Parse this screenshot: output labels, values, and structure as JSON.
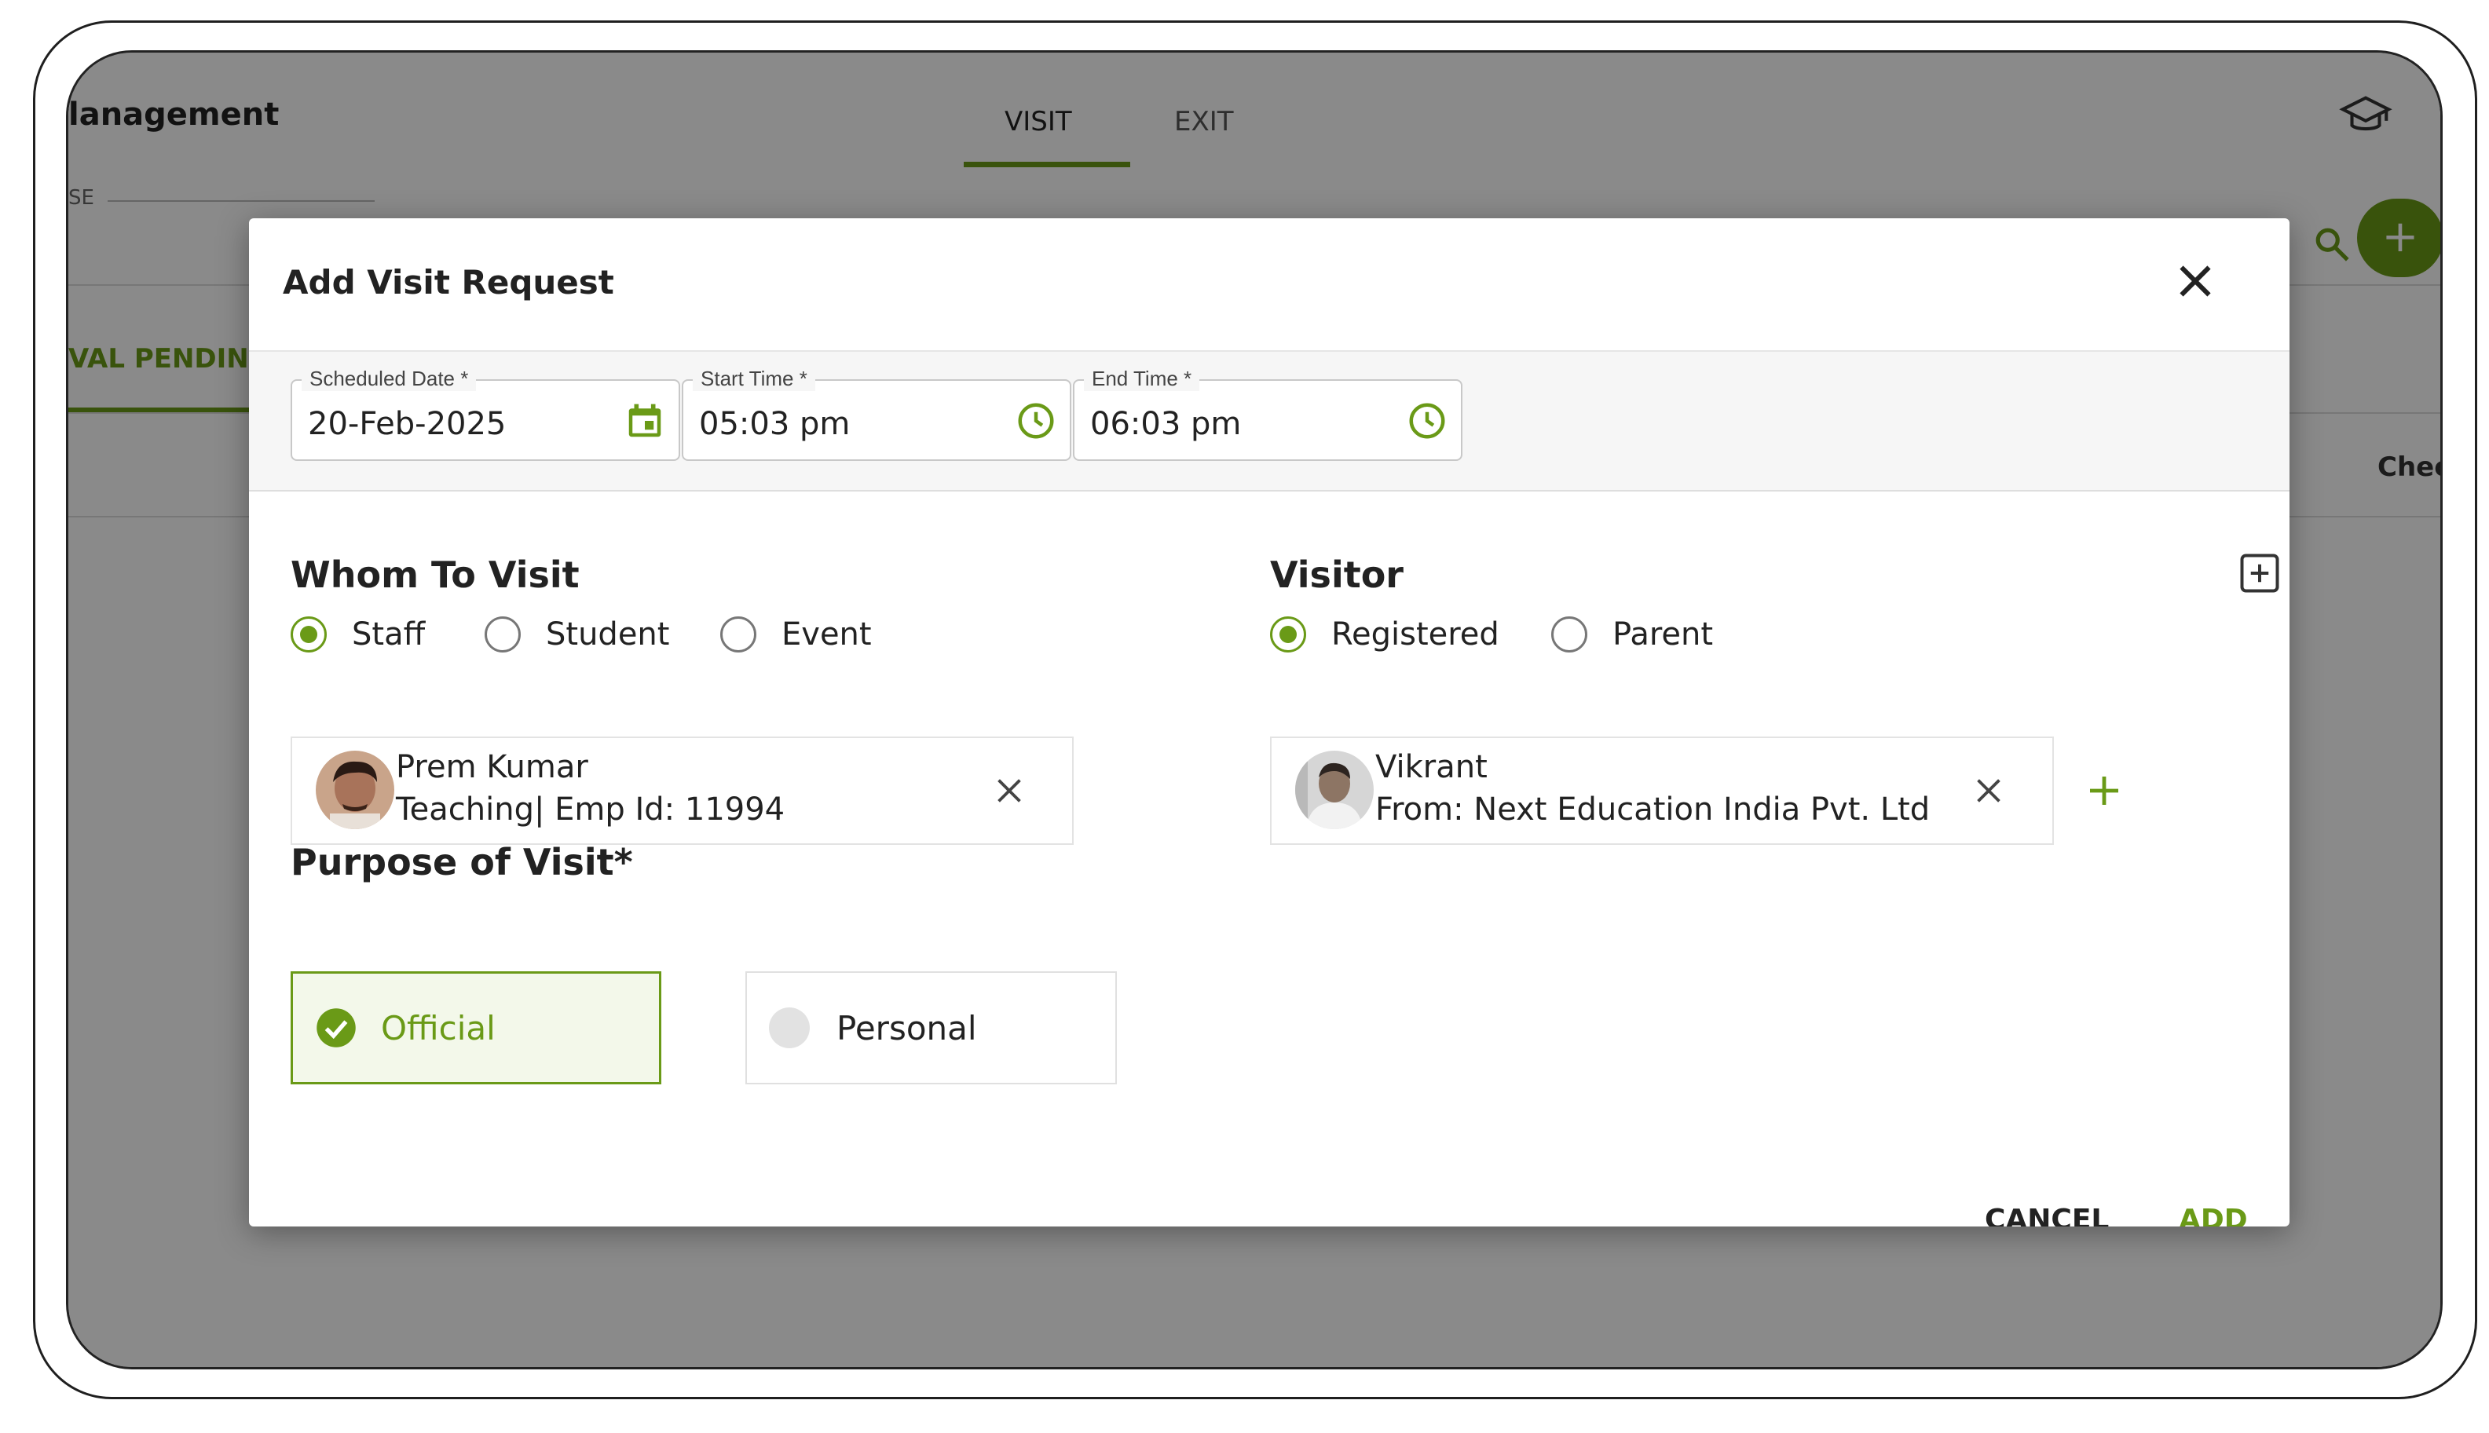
{
  "background_app": {
    "title": "lanagement",
    "tabs": [
      {
        "label": "VISIT",
        "active": true
      },
      {
        "label": "EXIT",
        "active": false
      }
    ],
    "field_label": "SE",
    "status_tab": "VAL PENDING",
    "column_header": "Chec",
    "add_button": "+"
  },
  "modal": {
    "title": "Add Visit Request",
    "schedule": {
      "date": {
        "label": "Scheduled Date *",
        "value": "20-Feb-2025",
        "icon": "calendar-icon"
      },
      "start": {
        "label": "Start Time *",
        "value": "05:03 pm",
        "icon": "clock-icon"
      },
      "end": {
        "label": "End Time *",
        "value": "06:03 pm",
        "icon": "clock-icon"
      }
    },
    "whom": {
      "heading": "Whom To Visit",
      "options": [
        {
          "label": "Staff",
          "selected": true
        },
        {
          "label": "Student",
          "selected": false
        },
        {
          "label": "Event",
          "selected": false
        }
      ],
      "selected": {
        "name": "Prem Kumar",
        "detail": "Teaching| Emp Id: 11994"
      }
    },
    "visitor": {
      "heading": "Visitor",
      "options": [
        {
          "label": "Registered",
          "selected": true
        },
        {
          "label": "Parent",
          "selected": false
        }
      ],
      "selected": {
        "name": "Vikrant",
        "detail": "From: Next Education India Pvt. Ltd"
      },
      "add_icon": "plus-icon"
    },
    "purpose": {
      "heading": "Purpose of Visit*",
      "options": [
        {
          "label": "Official",
          "selected": true
        },
        {
          "label": "Personal",
          "selected": false
        }
      ]
    },
    "actions": {
      "cancel": "CANCEL",
      "submit": "ADD VISIT"
    }
  },
  "colors": {
    "accent": "#6a9a17",
    "overlay": "rgba(0,0,0,0.46)"
  }
}
